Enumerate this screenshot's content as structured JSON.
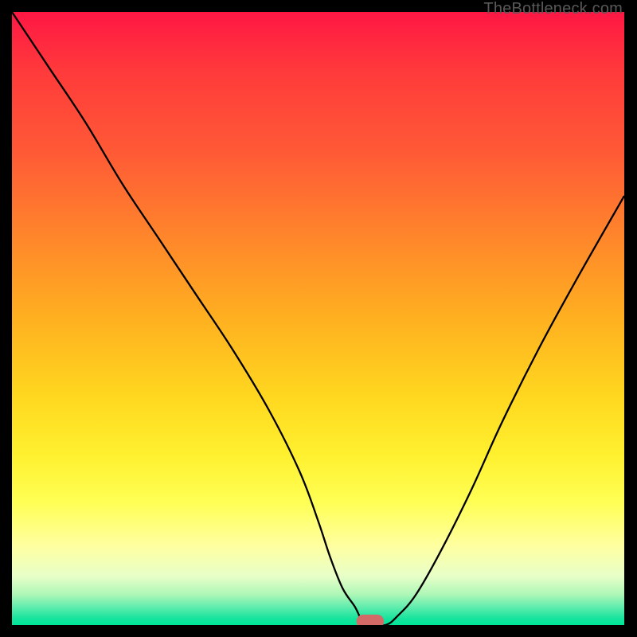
{
  "watermark": {
    "text": "TheBottleneck.com"
  },
  "chart_data": {
    "type": "line",
    "title": "",
    "xlabel": "",
    "ylabel": "",
    "xlim": [
      0,
      100
    ],
    "ylim": [
      0,
      100
    ],
    "grid": false,
    "legend": false,
    "series": [
      {
        "name": "bottleneck-curve",
        "x": [
          0,
          6,
          12,
          18,
          24,
          30,
          36,
          42,
          47,
          50,
          52,
          54,
          56,
          57,
          58,
          61,
          63,
          66,
          70,
          75,
          80,
          86,
          92,
          100
        ],
        "y": [
          100,
          91,
          82,
          72,
          63,
          54,
          45,
          35,
          25,
          17,
          11,
          6,
          3,
          1,
          0,
          0,
          1.5,
          5,
          12,
          22,
          33,
          45,
          56,
          70
        ]
      }
    ],
    "marker": {
      "name": "optimal-point",
      "x": 58.5,
      "y": 0,
      "color": "#d36a68",
      "w": 4.5,
      "h": 2.2
    },
    "background_gradient_stops": [
      {
        "pos": 0.0,
        "color": "#ff1744"
      },
      {
        "pos": 0.1,
        "color": "#ff3b3b"
      },
      {
        "pos": 0.23,
        "color": "#ff5a36"
      },
      {
        "pos": 0.38,
        "color": "#ff8a2a"
      },
      {
        "pos": 0.5,
        "color": "#ffb020"
      },
      {
        "pos": 0.63,
        "color": "#ffd81f"
      },
      {
        "pos": 0.72,
        "color": "#fff02e"
      },
      {
        "pos": 0.8,
        "color": "#ffff55"
      },
      {
        "pos": 0.87,
        "color": "#ffffa0"
      },
      {
        "pos": 0.92,
        "color": "#e8ffc8"
      },
      {
        "pos": 0.95,
        "color": "#aef7b7"
      },
      {
        "pos": 0.97,
        "color": "#62edae"
      },
      {
        "pos": 0.99,
        "color": "#14e39d"
      },
      {
        "pos": 1.0,
        "color": "#00e79a"
      }
    ]
  }
}
